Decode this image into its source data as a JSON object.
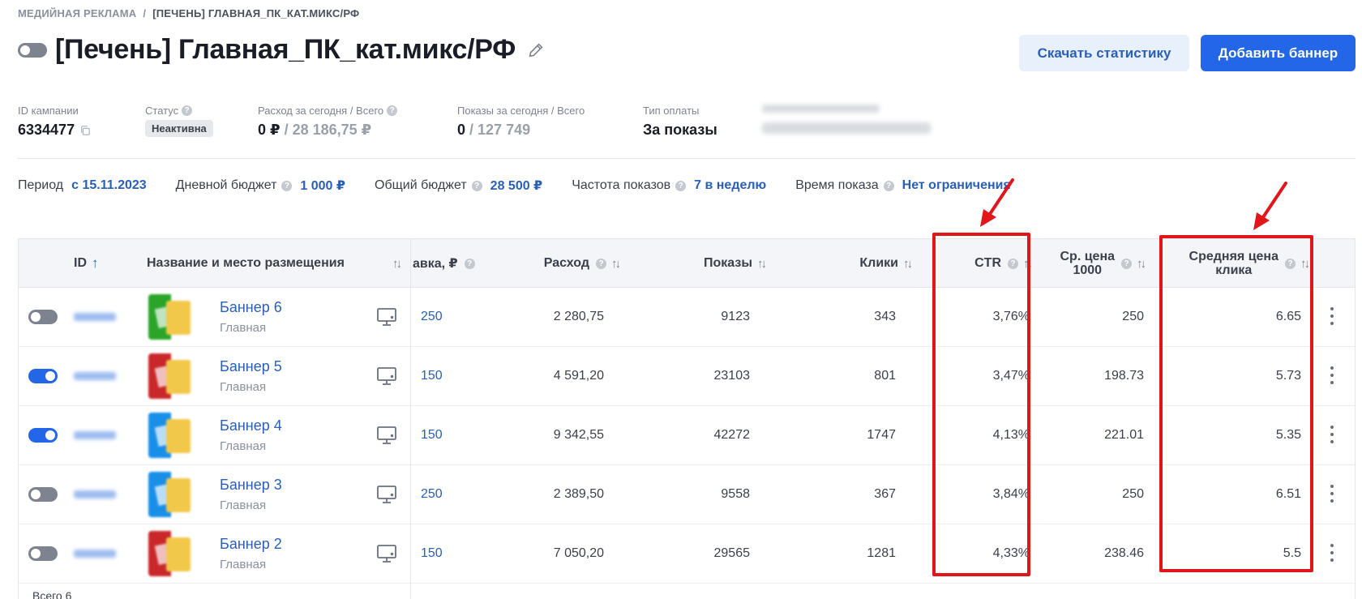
{
  "breadcrumb": {
    "root": "Медийная реклама",
    "separator": "/",
    "current": "[Печень] Главная_ПК_кат.микс/РФ"
  },
  "page": {
    "title": "[Печень] Главная_ПК_кат.микс/РФ",
    "campaign_active": false
  },
  "actions": {
    "download": "Скачать статистику",
    "add_banner": "Добавить баннер"
  },
  "info": {
    "campaign_id_label": "ID кампании",
    "campaign_id": "6334477",
    "status_label": "Статус",
    "status": "Неактивна",
    "spend_label": "Расход за сегодня / Всего",
    "spend_today": "0 ₽",
    "spend_total": "/ 28 186,75 ₽",
    "views_label": "Показы за сегодня / Всего",
    "views_today": "0",
    "views_total": "/ 127 749",
    "pay_type_label": "Тип оплаты",
    "pay_type": "За показы"
  },
  "params": {
    "period_label": "Период",
    "period": "с 15.11.2023",
    "daily_budget_label": "Дневной бюджет",
    "daily_budget": "1 000 ₽",
    "total_budget_label": "Общий бюджет",
    "total_budget": "28 500 ₽",
    "frequency_label": "Частота показов",
    "frequency": "7 в неделю",
    "time_label": "Время показа",
    "time": "Нет ограничения"
  },
  "table": {
    "headers": {
      "id": "ID",
      "name": "Название и место размещения",
      "bid": "авка, ₽",
      "spend": "Расход",
      "views": "Показы",
      "clicks": "Клики",
      "ctr": "CTR",
      "cpm_line1": "Ср. цена",
      "cpm_line2": "1000",
      "cpc_line1": "Средняя цена",
      "cpc_line2": "клика"
    },
    "rows": [
      {
        "active": false,
        "thumb": "#2aa52a",
        "name": "Баннер 6",
        "place": "Главная",
        "bid": "250",
        "spend": "2 280,75",
        "views": "9123",
        "clicks": "343",
        "ctr": "3,76%",
        "cpm": "250",
        "cpc": "6.65"
      },
      {
        "active": true,
        "thumb": "#c9282b",
        "name": "Баннер 5",
        "place": "Главная",
        "bid": "150",
        "spend": "4 591,20",
        "views": "23103",
        "clicks": "801",
        "ctr": "3,47%",
        "cpm": "198.73",
        "cpc": "5.73"
      },
      {
        "active": true,
        "thumb": "#1a8fe8",
        "name": "Баннер 4",
        "place": "Главная",
        "bid": "150",
        "spend": "9 342,55",
        "views": "42272",
        "clicks": "1747",
        "ctr": "4,13%",
        "cpm": "221.01",
        "cpc": "5.35"
      },
      {
        "active": false,
        "thumb": "#1a8fe8",
        "name": "Баннер 3",
        "place": "Главная",
        "bid": "250",
        "spend": "2 389,50",
        "views": "9558",
        "clicks": "367",
        "ctr": "3,84%",
        "cpm": "250",
        "cpc": "6.51"
      },
      {
        "active": false,
        "thumb": "#c9282b",
        "name": "Баннер 2",
        "place": "Главная",
        "bid": "150",
        "spend": "7 050,20",
        "views": "29565",
        "clicks": "1281",
        "ctr": "4,33%",
        "cpm": "238.46",
        "cpc": "5.5"
      }
    ],
    "footer": "Всего 6"
  },
  "highlight_color": "#e0161b"
}
